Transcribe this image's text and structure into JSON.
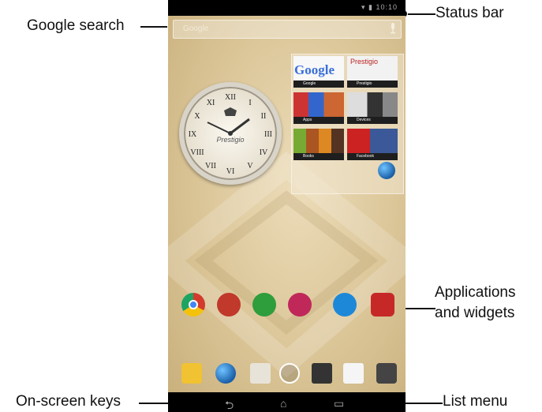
{
  "callouts": {
    "google_search": "Google search",
    "status_bar": "Status bar",
    "applications_and_widgets": "Applications and widgets",
    "on_screen_keys": "On-screen keys",
    "list_menu": "List menu"
  },
  "device": {
    "status_time": "10:10",
    "search_placeholder": "Google",
    "clock_brand": "Prestigio",
    "folder_tiles": [
      {
        "label": "Google",
        "google_word": "Google"
      },
      {
        "label": "Prestigio",
        "brand_word": "Prestigio"
      },
      {
        "label": "Apps"
      },
      {
        "label": "Devices"
      },
      {
        "label": "Books"
      },
      {
        "label": "Facebook"
      }
    ],
    "apps": [
      {
        "icon": "chrome-icon",
        "color": "#d33a2c"
      },
      {
        "icon": "book-app-icon",
        "color": "#c0392b"
      },
      {
        "icon": "download-app-icon",
        "color": "#2e9d3c"
      },
      {
        "icon": "store-app-icon",
        "color": "#c0285a"
      },
      {
        "icon": "cloud-app-icon",
        "color": "#1e88d8"
      },
      {
        "icon": "mcafee-icon",
        "color": "#c62828"
      }
    ],
    "dock": [
      "email-icon",
      "browser-icon",
      "gallery-icon",
      "app-drawer-icon",
      "video-icon",
      "play-store-icon",
      "camera-icon"
    ],
    "nav_keys": [
      "back-icon",
      "home-icon",
      "recents-icon"
    ]
  }
}
